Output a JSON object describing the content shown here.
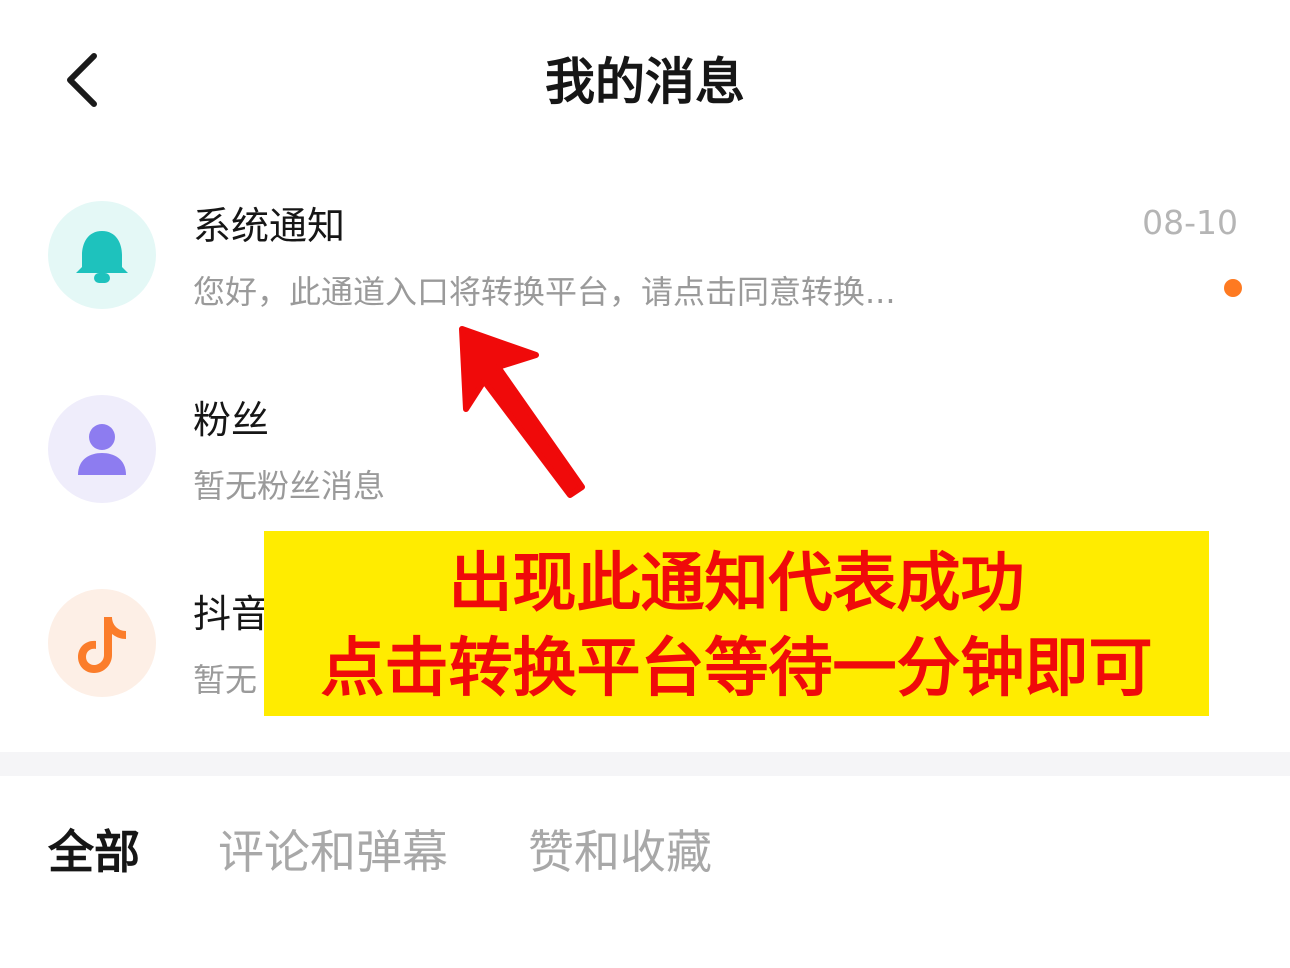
{
  "header": {
    "title": "我的消息",
    "back_icon": "chevron-left-icon"
  },
  "messages": [
    {
      "title": "系统通知",
      "preview": "您好，此通道入口将转换平台，请点击同意转换...",
      "date": "08-10",
      "unread": true,
      "icon": "bell-icon",
      "icon_bg": "#e4f8f6",
      "icon_color": "#1ec2bd"
    },
    {
      "title": "粉丝",
      "preview": "暂无粉丝消息",
      "icon": "person-icon",
      "icon_bg": "#efedfb",
      "icon_color": "#8d7cf0"
    },
    {
      "title": "抖音",
      "preview": "暂无",
      "icon": "tiktok-icon",
      "icon_bg": "#fdefe6",
      "icon_color": "#fb7d2b"
    }
  ],
  "tabs": [
    {
      "label": "全部",
      "active": true
    },
    {
      "label": "评论和弹幕",
      "active": false
    },
    {
      "label": "赞和收藏",
      "active": false
    }
  ],
  "annotation": {
    "line1": "出现此通知代表成功",
    "line2": "点击转换平台等待一分钟即可",
    "box_color": "#ffec00",
    "text_color": "#f00a0a",
    "arrow_color": "#f00a0a"
  },
  "colors": {
    "unread_dot": "#fe7a21",
    "divider": "#f5f5f7"
  }
}
